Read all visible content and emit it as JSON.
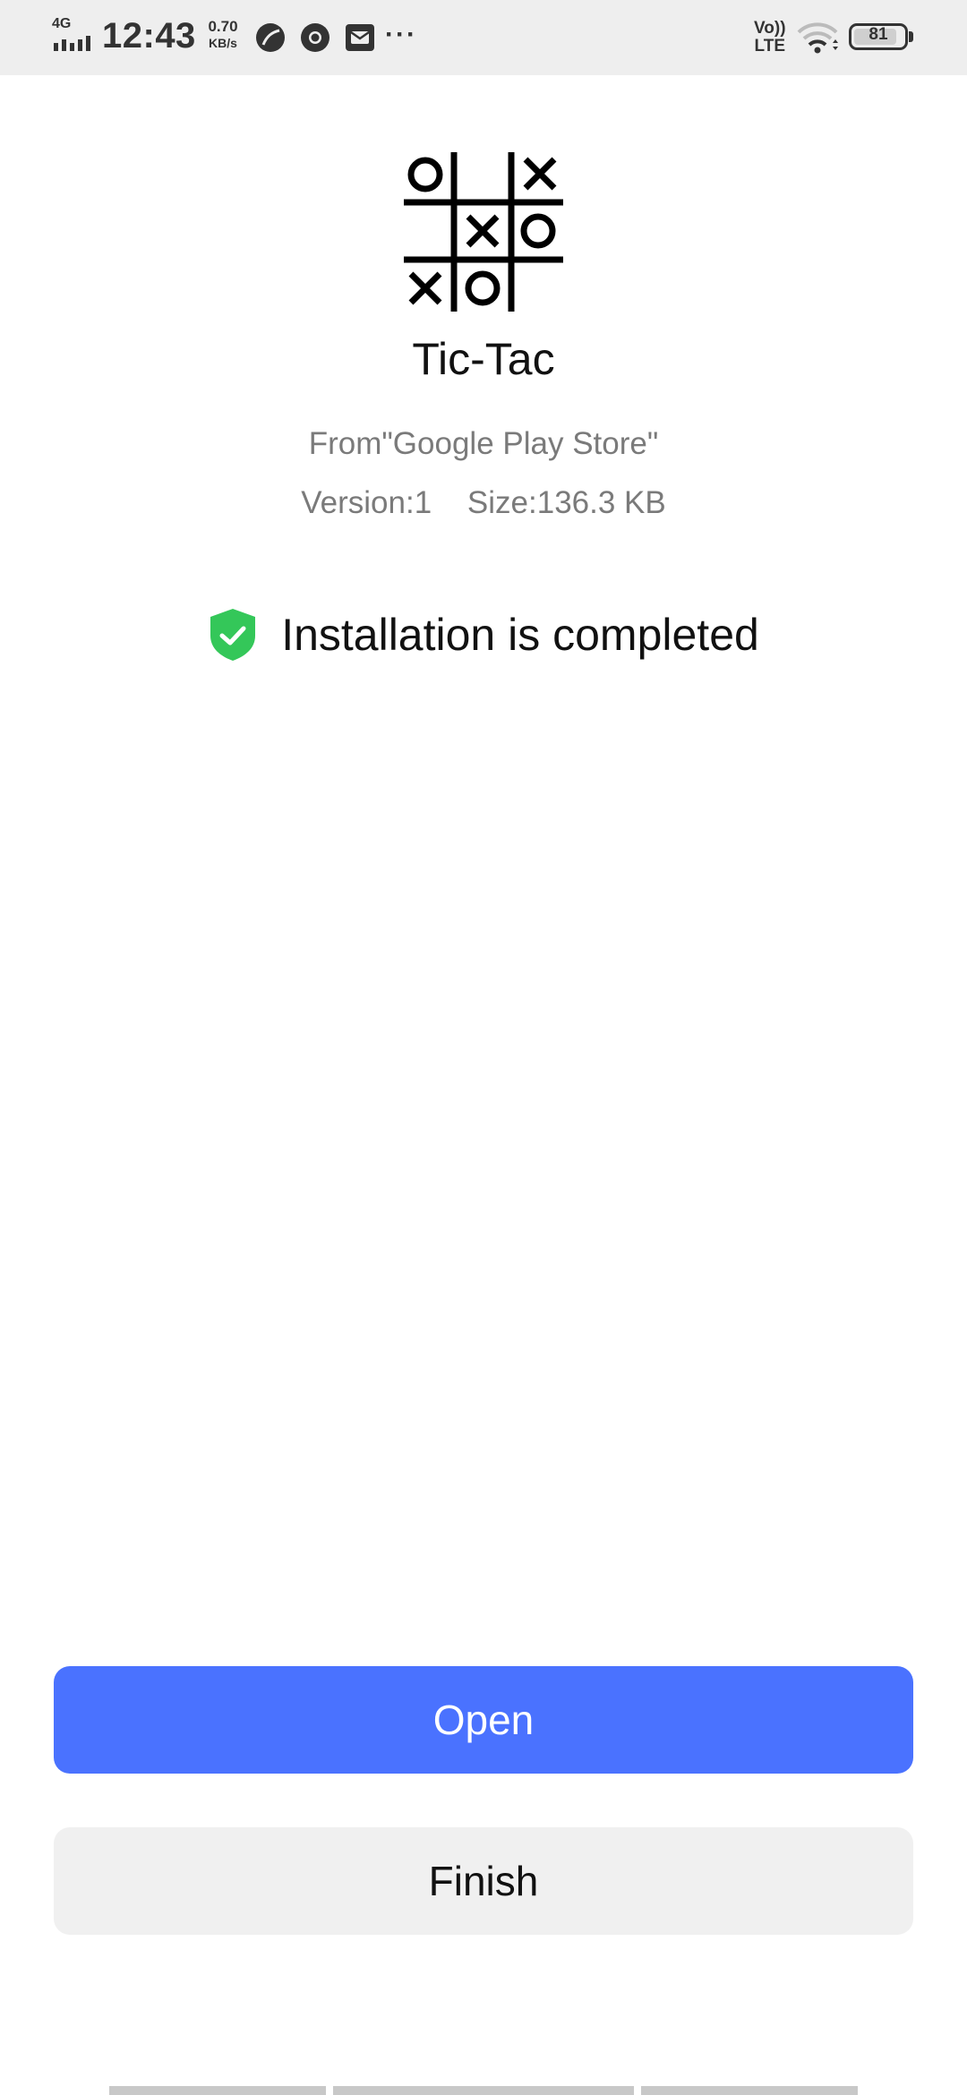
{
  "status_bar": {
    "network": "4G",
    "time": "12:43",
    "speed_value": "0.70",
    "speed_unit": "KB/s",
    "more": "···",
    "volte_top": "Vo))",
    "volte_bottom": "LTE",
    "battery": "81"
  },
  "app": {
    "name": "Tic-Tac",
    "source": "From\"Google Play Store\"",
    "version": "Version:1",
    "size": "Size:136.3 KB",
    "logo_icon": "tic-tac-toe-grid-icon"
  },
  "install": {
    "status_text": "Installation is completed",
    "status_icon": "green-shield-check-icon",
    "status_color": "#34c759"
  },
  "actions": {
    "open_label": "Open",
    "finish_label": "Finish",
    "primary_color": "#4a72ff"
  }
}
